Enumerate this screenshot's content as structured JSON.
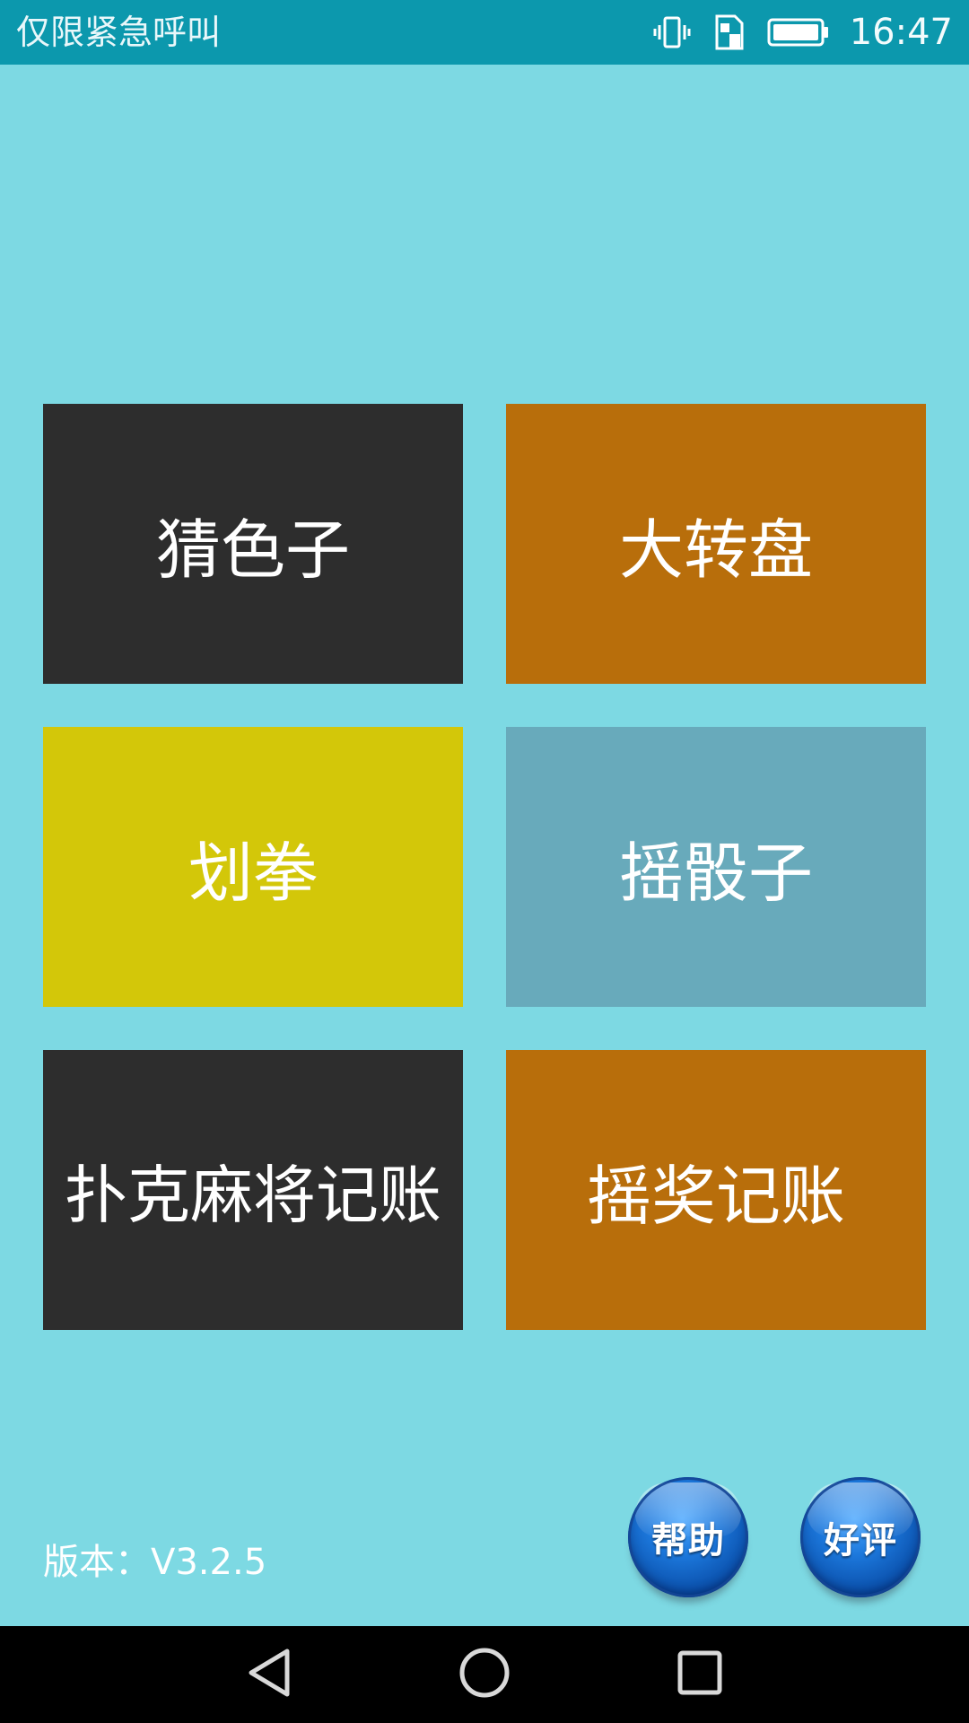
{
  "status_bar": {
    "carrier": "仅限紧急呼叫",
    "time": "16:47",
    "icons": [
      "vibrate-icon",
      "sim-card-icon",
      "battery-icon"
    ]
  },
  "menu": {
    "tiles": [
      {
        "label": "猜色子",
        "color": "#2d2d2d"
      },
      {
        "label": "大转盘",
        "color": "#b86e0b"
      },
      {
        "label": "划拳",
        "color": "#d3c709"
      },
      {
        "label": "摇骰子",
        "color": "#68aabb"
      },
      {
        "label": "扑克麻将记账",
        "color": "#2d2d2d"
      },
      {
        "label": "摇奖记账",
        "color": "#b86e0b"
      }
    ]
  },
  "footer": {
    "version": "版本：V3.2.5",
    "help_label": "帮助",
    "review_label": "好评"
  },
  "nav_bar": {
    "icons": [
      "back-icon",
      "home-icon",
      "recent-apps-icon"
    ]
  },
  "colors": {
    "background": "#7dd9e3",
    "status_bar": "#0c98ad",
    "button_blue": "#1c78dc"
  }
}
